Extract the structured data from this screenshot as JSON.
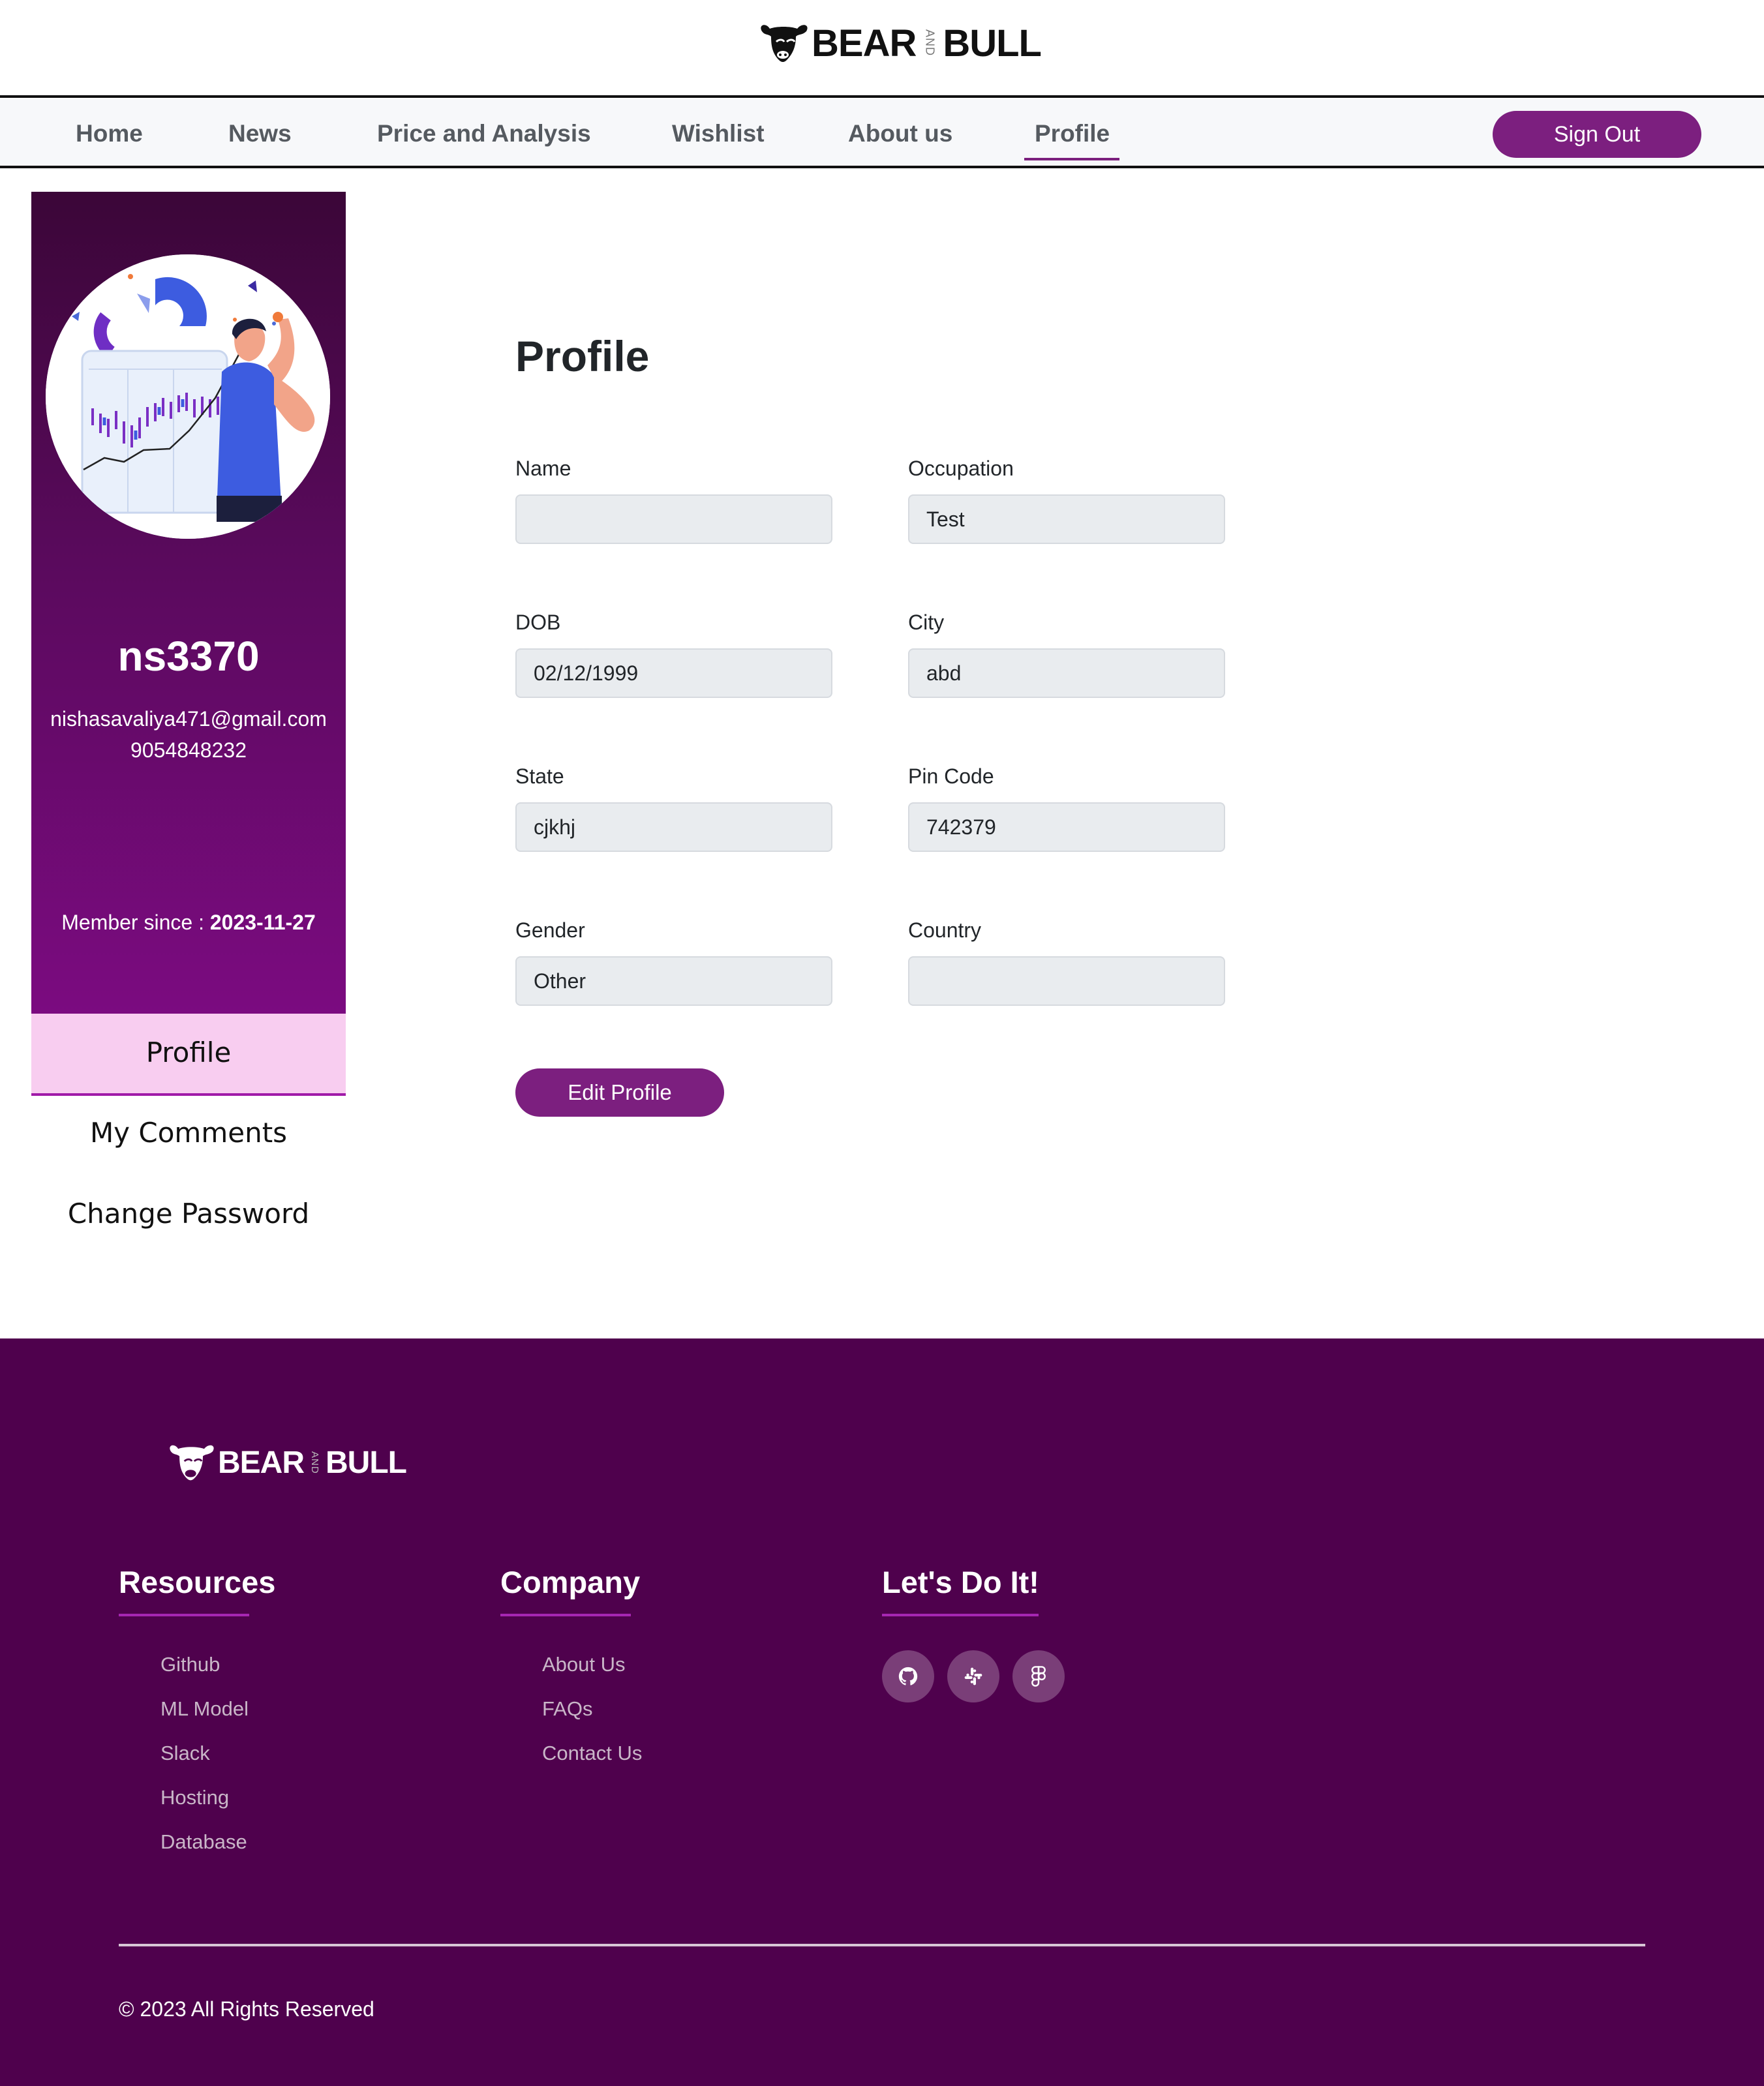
{
  "header": {
    "brand_left": "BEAR",
    "brand_and": "AND",
    "brand_right": "BULL"
  },
  "nav": {
    "items": [
      {
        "label": "Home"
      },
      {
        "label": "News"
      },
      {
        "label": "Price and Analysis"
      },
      {
        "label": "Wishlist"
      },
      {
        "label": "About us"
      },
      {
        "label": "Profile",
        "active": true
      }
    ],
    "signout_label": "Sign Out"
  },
  "sidebar": {
    "username": "ns3370",
    "email": "nishasavaliya471@gmail.com",
    "phone": "9054848232",
    "member_since_label": "Member since :",
    "member_since_date": "2023-11-27",
    "tabs": [
      {
        "label": "Profile",
        "active": true
      },
      {
        "label": "My Comments"
      },
      {
        "label": "Change Password"
      }
    ]
  },
  "profile": {
    "title": "Profile",
    "fields": {
      "name": {
        "label": "Name",
        "value": ""
      },
      "occupation": {
        "label": "Occupation",
        "value": "Test"
      },
      "dob": {
        "label": "DOB",
        "value": "02/12/1999"
      },
      "city": {
        "label": "City",
        "value": "abd"
      },
      "state": {
        "label": "State",
        "value": "cjkhj"
      },
      "pin_code": {
        "label": "Pin Code",
        "value": "742379"
      },
      "gender": {
        "label": "Gender",
        "value": "Other"
      },
      "country": {
        "label": "Country",
        "value": ""
      }
    },
    "edit_label": "Edit Profile"
  },
  "footer": {
    "brand_left": "BEAR",
    "brand_and": "AND",
    "brand_right": "BULL",
    "resources": {
      "heading": "Resources",
      "links": [
        "Github",
        "ML Model",
        "Slack",
        "Hosting",
        "Database"
      ]
    },
    "company": {
      "heading": "Company",
      "links": [
        "About Us",
        "FAQs",
        "Contact Us"
      ]
    },
    "social": {
      "heading": "Let's Do It!",
      "icons": [
        "github-icon",
        "slack-icon",
        "figma-icon"
      ]
    },
    "copyright": "© 2023 All Rights Reserved"
  },
  "colors": {
    "accent": "#7c1f7f",
    "footer_bg": "#4f014d",
    "sidebar_top": "#3b0638",
    "sidebar_bottom": "#7b0b80",
    "active_tab_bg": "#f8cdf0"
  }
}
